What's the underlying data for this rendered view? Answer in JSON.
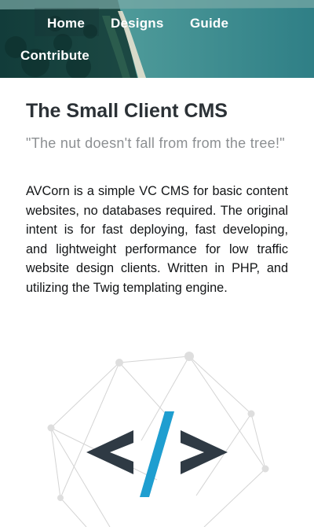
{
  "nav": {
    "items": [
      {
        "label": "Home"
      },
      {
        "label": "Designs"
      },
      {
        "label": "Guide"
      },
      {
        "label": "Contribute"
      }
    ]
  },
  "main": {
    "title": "The Small Client CMS",
    "quote": "\"The nut doesn't fall from from the tree!\"",
    "description": "AVCorn is a simple VC CMS for basic content websites, no databases required. The original intent is for fast deploying, fast developing, and lightweight performance for low traffic website design clients. Written in PHP, and utilizing the Twig templating engine."
  },
  "graphic": {
    "icon": "code-brackets-icon",
    "decoration": "network-lines-icon"
  },
  "colors": {
    "title": "#2b3136",
    "quote": "#8c8f92",
    "text": "#121416",
    "slash_blue": "#1f9ed0",
    "bracket_dark": "#2f3a44"
  }
}
